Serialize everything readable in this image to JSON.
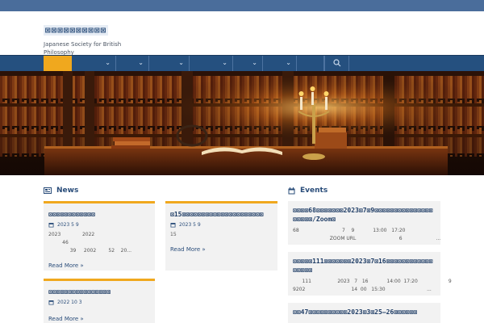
{
  "site": {
    "title": "⊠⊠⊠⊠⊠⊠⊠⊠⊠⊠",
    "subtitle": "Japanese Society for British Philosophy"
  },
  "nav": {
    "items": [
      "",
      "",
      "",
      "",
      "",
      ""
    ],
    "search_icon": "search-icon"
  },
  "hero": {
    "image": "library-bookshelves-candelabra"
  },
  "news": {
    "heading": "News",
    "items": [
      {
        "title": "⊠⊠⊠⊠⊠⊠⊠⊠⊠⊠⊠⊠",
        "date": "2023  5  9",
        "excerpt": "2023              2022\n         46\n              39     2002        52    20...",
        "more": "Read More »"
      },
      {
        "title": "⊠15⊠⊠⊠⊠⊠⊠⊠⊠⊠⊠⊠⊠⊠⊠⊠⊠⊠⊠⊠⊠⊠",
        "date": "2023  5  9",
        "excerpt": "15",
        "more": "Read More »"
      },
      {
        "title": "⊠⊠⊠⊠⊠⊠⊠⊠⊠⊠⊠⊠⊠⊠⊠⊠",
        "date": "2022  10  3",
        "excerpt": "",
        "more": "Read More »"
      }
    ]
  },
  "events": {
    "heading": "Events",
    "items": [
      {
        "title": "⊠⊠⊠⊠68⊠⊠⊠⊠⊠⊠⊠2023⊠7⊠9⊠⊠⊠⊠⊠⊠⊠⊠⊠⊠⊠⊠⊠⊠⊠⊠⊠⊠⊠⊠/Zoom⊠",
        "text": "68                            7    9            13:00   17:20\n                        ZOOM URL                            6                      ..."
      },
      {
        "title": "⊠⊠⊠⊠⊠111⊠⊠⊠⊠⊠⊠⊠2023⊠7⊠16⊠⊠⊠⊠⊠⊠⊠⊠⊠⊠⊠⊠⊠⊠⊠⊠⊠",
        "text": "      111                 2023   7   16            14:00  17:20                    9\n9202                              14  00   15:30                           ..."
      },
      {
        "title": "⊠⊠47⊠⊠⊠⊠⊠⊠⊠⊠⊠⊠2023⊠3⊠25–26⊠⊠⊠⊠⊠⊠",
        "text": ""
      }
    ]
  },
  "colors": {
    "primary": "#25507f",
    "accent": "#f0a81e",
    "topbar": "#4a6d9b",
    "card_bg": "#f2f2f2"
  }
}
